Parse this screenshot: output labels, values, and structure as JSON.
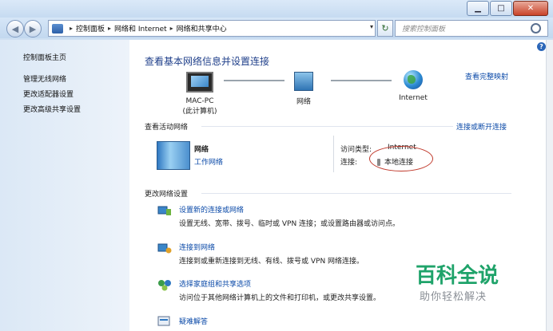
{
  "window": {
    "min_label": "▁",
    "max_label": "□",
    "close_label": "✕"
  },
  "nav": {
    "back_label": "◀",
    "forward_label": "▶"
  },
  "address": {
    "crumbs": [
      "控制面板",
      "网络和 Internet",
      "网络和共享中心"
    ],
    "separator": "▸",
    "dropdown_label": "▾",
    "refresh_label": "↻"
  },
  "search": {
    "placeholder": "搜索控制面板"
  },
  "sidebar": {
    "items": [
      {
        "label": "控制面板主页"
      },
      {
        "label": "管理无线网络"
      },
      {
        "label": "更改适配器设置"
      },
      {
        "label": "更改高级共享设置"
      }
    ]
  },
  "main": {
    "help_label": "?",
    "heading": "查看基本网络信息并设置连接",
    "map_link": "查看完整映射",
    "nodes": {
      "pc_name": "MAC-PC",
      "pc_sub": "(此计算机)",
      "network": "网络",
      "internet": "Internet"
    },
    "active": {
      "title": "查看活动网络",
      "connect_link": "连接或断开连接",
      "network_name": "网络",
      "network_type": "工作网络",
      "access_label": "访问类型:",
      "access_value": "Internet",
      "conn_label": "连接:",
      "conn_value": "本地连接"
    },
    "change": {
      "title": "更改网络设置",
      "options": [
        {
          "title": "设置新的连接或网络",
          "desc": "设置无线、宽带、拨号、临时或 VPN 连接；或设置路由器或访问点。"
        },
        {
          "title": "连接到网络",
          "desc": "连接到或重新连接到无线、有线、拨号或 VPN 网络连接。"
        },
        {
          "title": "选择家庭组和共享选项",
          "desc": "访问位于其他网络计算机上的文件和打印机，或更改共享设置。"
        },
        {
          "title": "疑难解答",
          "desc": ""
        }
      ]
    }
  },
  "watermark": {
    "title": "百科全说",
    "subtitle": "助你轻松解决"
  }
}
